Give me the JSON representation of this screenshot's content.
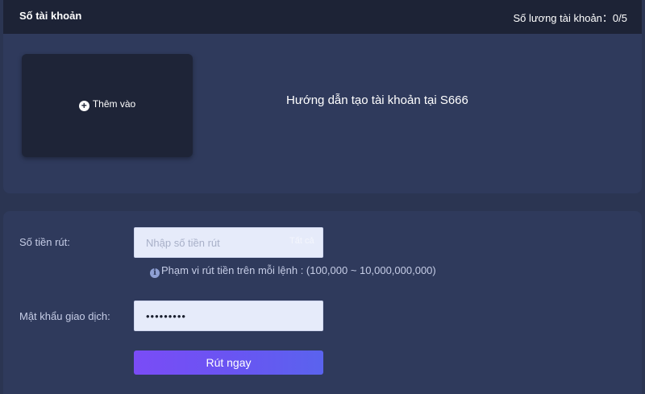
{
  "header": {
    "title": "Số tài khoản",
    "account_count_label": "Số lương tài khoản：0/5"
  },
  "account_panel": {
    "add_label": "Thêm vào",
    "guide_link": "Hướng dẫn tạo tài khoản tại S666"
  },
  "withdraw_form": {
    "amount_label": "Số tiền rút:",
    "amount_placeholder": "Nhập số tiền rút",
    "amount_value": "",
    "amount_suffix": "Tất cả",
    "range_hint": "Phạm vi rút tiền trên mỗi lệnh : (100,000 ~ 10,000,000,000)",
    "password_label": "Mật khẩu giao dịch:",
    "password_value": "•••••••••",
    "submit_label": "Rút ngay"
  }
}
